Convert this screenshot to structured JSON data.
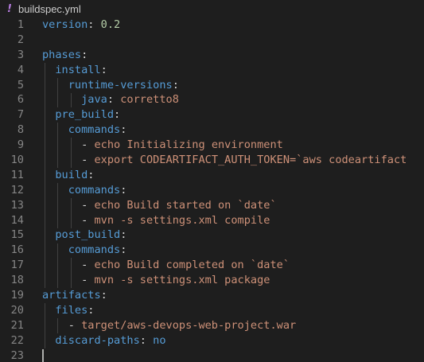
{
  "tab": {
    "icon": "!",
    "icon_name": "yaml-exclamation-icon",
    "filename": "buildspec.yml"
  },
  "colors": {
    "background": "#1e1e1e",
    "key": "#569cd6",
    "string": "#ce9178",
    "number": "#b5cea8",
    "line_number": "#858585",
    "text": "#d4d4d4"
  },
  "lines": [
    {
      "num": "1",
      "indent": 0,
      "tokens": [
        {
          "t": "version",
          "c": "key"
        },
        {
          "t": ": ",
          "c": "punct"
        },
        {
          "t": "0.2",
          "c": "num"
        }
      ]
    },
    {
      "num": "2",
      "indent": 0,
      "tokens": []
    },
    {
      "num": "3",
      "indent": 0,
      "tokens": [
        {
          "t": "phases",
          "c": "key"
        },
        {
          "t": ":",
          "c": "punct"
        }
      ]
    },
    {
      "num": "4",
      "indent": 1,
      "tokens": [
        {
          "t": "install",
          "c": "key"
        },
        {
          "t": ":",
          "c": "punct"
        }
      ]
    },
    {
      "num": "5",
      "indent": 2,
      "tokens": [
        {
          "t": "runtime-versions",
          "c": "key"
        },
        {
          "t": ":",
          "c": "punct"
        }
      ]
    },
    {
      "num": "6",
      "indent": 3,
      "tokens": [
        {
          "t": "java",
          "c": "key"
        },
        {
          "t": ": ",
          "c": "punct"
        },
        {
          "t": "corretto8",
          "c": "str"
        }
      ]
    },
    {
      "num": "7",
      "indent": 1,
      "tokens": [
        {
          "t": "pre_build",
          "c": "key"
        },
        {
          "t": ":",
          "c": "punct"
        }
      ]
    },
    {
      "num": "8",
      "indent": 2,
      "tokens": [
        {
          "t": "commands",
          "c": "key"
        },
        {
          "t": ":",
          "c": "punct"
        }
      ]
    },
    {
      "num": "9",
      "indent": 3,
      "tokens": [
        {
          "t": "- ",
          "c": "punct"
        },
        {
          "t": "echo Initializing environment",
          "c": "str"
        }
      ]
    },
    {
      "num": "10",
      "indent": 3,
      "tokens": [
        {
          "t": "- ",
          "c": "punct"
        },
        {
          "t": "export CODEARTIFACT_AUTH_TOKEN=`aws codeartifact",
          "c": "str"
        }
      ]
    },
    {
      "num": "11",
      "indent": 1,
      "tokens": [
        {
          "t": "build",
          "c": "key"
        },
        {
          "t": ":",
          "c": "punct"
        }
      ]
    },
    {
      "num": "12",
      "indent": 2,
      "tokens": [
        {
          "t": "commands",
          "c": "key"
        },
        {
          "t": ":",
          "c": "punct"
        }
      ]
    },
    {
      "num": "13",
      "indent": 3,
      "tokens": [
        {
          "t": "- ",
          "c": "punct"
        },
        {
          "t": "echo Build started on `date`",
          "c": "str"
        }
      ]
    },
    {
      "num": "14",
      "indent": 3,
      "tokens": [
        {
          "t": "- ",
          "c": "punct"
        },
        {
          "t": "mvn -s settings.xml compile",
          "c": "str"
        }
      ]
    },
    {
      "num": "15",
      "indent": 1,
      "tokens": [
        {
          "t": "post_build",
          "c": "key"
        },
        {
          "t": ":",
          "c": "punct"
        }
      ]
    },
    {
      "num": "16",
      "indent": 2,
      "tokens": [
        {
          "t": "commands",
          "c": "key"
        },
        {
          "t": ":",
          "c": "punct"
        }
      ]
    },
    {
      "num": "17",
      "indent": 3,
      "tokens": [
        {
          "t": "- ",
          "c": "punct"
        },
        {
          "t": "echo Build completed on `date`",
          "c": "str"
        }
      ]
    },
    {
      "num": "18",
      "indent": 3,
      "tokens": [
        {
          "t": "- ",
          "c": "punct"
        },
        {
          "t": "mvn -s settings.xml package",
          "c": "str"
        }
      ]
    },
    {
      "num": "19",
      "indent": 0,
      "tokens": [
        {
          "t": "artifacts",
          "c": "key"
        },
        {
          "t": ":",
          "c": "punct"
        }
      ]
    },
    {
      "num": "20",
      "indent": 1,
      "tokens": [
        {
          "t": "files",
          "c": "key"
        },
        {
          "t": ":",
          "c": "punct"
        }
      ]
    },
    {
      "num": "21",
      "indent": 2,
      "tokens": [
        {
          "t": "- ",
          "c": "punct"
        },
        {
          "t": "target/aws-devops-web-project.war",
          "c": "str"
        }
      ]
    },
    {
      "num": "22",
      "indent": 1,
      "tokens": [
        {
          "t": "discard-paths",
          "c": "key"
        },
        {
          "t": ": ",
          "c": "punct"
        },
        {
          "t": "no",
          "c": "bool"
        }
      ]
    },
    {
      "num": "23",
      "indent": 0,
      "tokens": []
    }
  ]
}
